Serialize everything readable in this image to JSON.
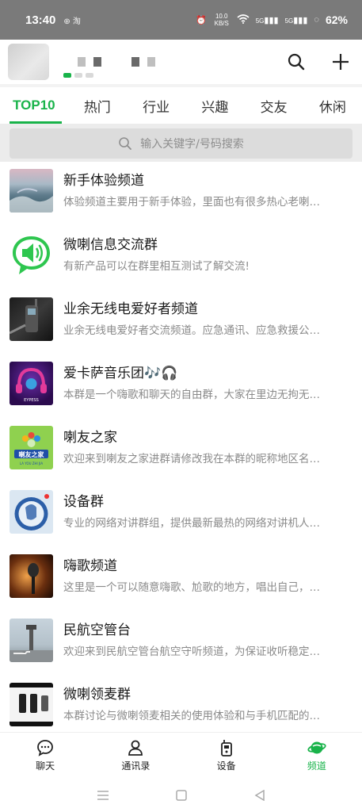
{
  "status": {
    "time": "13:40",
    "left_icons": "⊕ 淘",
    "net_speed": "10.0 KB/S",
    "signal1": "5G",
    "signal2": "5G",
    "battery": "62%"
  },
  "header": {
    "title_redacted": true
  },
  "tabs": [
    {
      "label": "TOP10"
    },
    {
      "label": "热门"
    },
    {
      "label": "行业"
    },
    {
      "label": "兴趣"
    },
    {
      "label": "交友"
    },
    {
      "label": "休闲"
    }
  ],
  "search": {
    "placeholder": "输入关键字/号码搜索"
  },
  "channels": [
    {
      "title": "新手体验频道",
      "desc": "体验频道主要用于新手体验，里面也有很多热心老喇…"
    },
    {
      "title": "微喇信息交流群",
      "desc": "有新产品可以在群里相互测试了解交流!"
    },
    {
      "title": "业余无线电爱好者频道",
      "desc": "业余无线电爱好者交流频道。应急通讯、应急救援公…"
    },
    {
      "title": "爱卡萨音乐团🎶🎧",
      "desc": "本群是一个嗨歌和聊天的自由群，大家在里边无拘无…"
    },
    {
      "title": "喇友之家",
      "desc": "欢迎来到喇友之家进群请修改我在本群的昵称地区名…"
    },
    {
      "title": "设备群",
      "desc": "专业的网络对讲群组，提供最新最热的网络对讲机人…"
    },
    {
      "title": "嗨歌频道",
      "desc": "这里是一个可以随意嗨歌、尬歌的地方，唱出自己，…"
    },
    {
      "title": "民航空管台",
      "desc": "欢迎来到民航空管台航空守听频道，为保证收听稳定…"
    },
    {
      "title": "微喇领麦群",
      "desc": "本群讨论与微喇领麦相关的使用体验和与手机匹配的…"
    }
  ],
  "thumb_texts": {
    "music_badge": "EYPESS",
    "home_badge": "喇友之家",
    "home_sub": "LA YOU ZHI JIA"
  },
  "bottom_nav": [
    {
      "label": "聊天",
      "icon": "chat-bubble-icon"
    },
    {
      "label": "通讯录",
      "icon": "contacts-icon"
    },
    {
      "label": "设备",
      "icon": "walkie-talkie-icon"
    },
    {
      "label": "频道",
      "icon": "planet-icon"
    }
  ],
  "colors": {
    "accent": "#19b34a",
    "status_bar": "#7a7a7a",
    "search_bg": "#dcdcdc"
  }
}
